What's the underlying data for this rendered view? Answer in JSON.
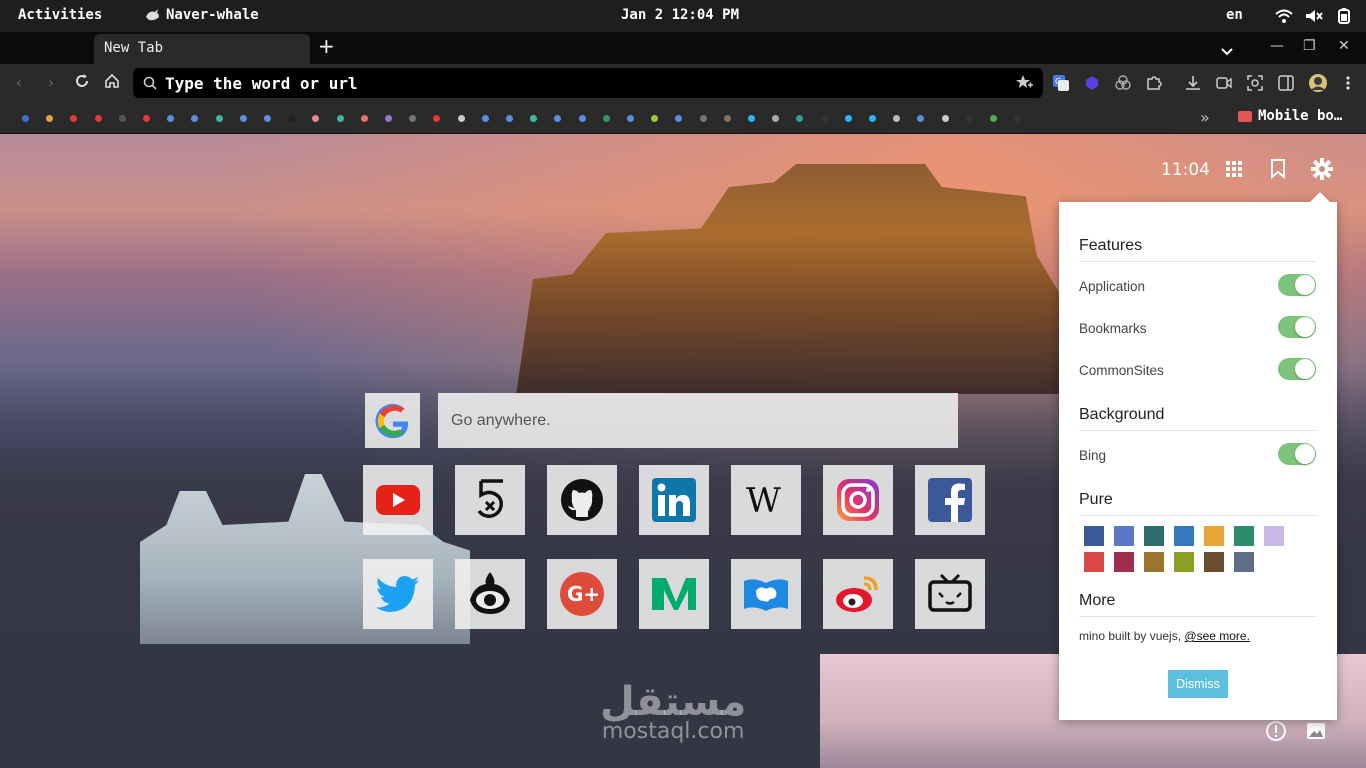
{
  "system_bar": {
    "activities": "Activities",
    "app_name": "Naver-whale",
    "datetime": "Jan 2  12:04 PM",
    "language": "en"
  },
  "browser": {
    "tab_title": "New Tab",
    "omnibox_placeholder": "Type the word or url",
    "bookmark_dot_colors": [
      "#3b6fd8",
      "#e8a33a",
      "#e53935",
      "#e53935",
      "#555",
      "#e53935",
      "#5c8ee6",
      "#5c8ee6",
      "#3fb8a6",
      "#5c8ee6",
      "#5c8ee6",
      "#222",
      "#e88",
      "#3fb8a6",
      "#e57373",
      "#9575cd",
      "#777",
      "#e53935",
      "#ccc",
      "#5c8ee6",
      "#5c8ee6",
      "#3fb8a6",
      "#5c8ee6",
      "#5c8ee6",
      "#2e9e5a",
      "#5c8ee6",
      "#9acd32",
      "#5c8ee6",
      "#777",
      "#8d6e63",
      "#29b6f6",
      "#aaa",
      "#26a69a",
      "#333",
      "#29b6f6",
      "#29b6f6",
      "#bbb",
      "#5c8ee6",
      "#ccc",
      "#333",
      "#4caf50",
      "#333"
    ],
    "bookmark_folder": "Mobile bo…"
  },
  "page": {
    "clock": "11:04",
    "search_placeholder": "Go anywhere.",
    "sites_row1": [
      "youtube-icon",
      "500px-icon",
      "github-icon",
      "linkedin-icon",
      "wikipedia-icon",
      "instagram-icon",
      "facebook-icon"
    ],
    "sites_row2": [
      "twitter-icon",
      "sina-eye-icon",
      "google-plus-icon",
      "medium-icon",
      "evernote-icon",
      "weibo-icon",
      "bilibili-tv-icon"
    ],
    "watermark_ar": "مستقل",
    "watermark_en": "mostaql.com"
  },
  "settings": {
    "features_heading": "Features",
    "application_label": "Application",
    "bookmarks_label": "Bookmarks",
    "commonsites_label": "CommonSites",
    "background_heading": "Background",
    "bing_label": "Bing",
    "pure_heading": "Pure",
    "pure_colors": [
      "#3d5a98",
      "#5a77c5",
      "#2c6e6e",
      "#3778c2",
      "#e8a438",
      "#2e8b6a",
      "#c9b8e6",
      "#d94848",
      "#9e2f4f",
      "#9a7530",
      "#8aa020",
      "#6b4c2e",
      "#5f6e86"
    ],
    "more_heading": "More",
    "more_text": "mino built by vuejs, ",
    "see_more": "@see more.",
    "dismiss": "Dismiss",
    "toggles": {
      "application": true,
      "bookmarks": true,
      "commonsites": true,
      "bing": true
    }
  }
}
